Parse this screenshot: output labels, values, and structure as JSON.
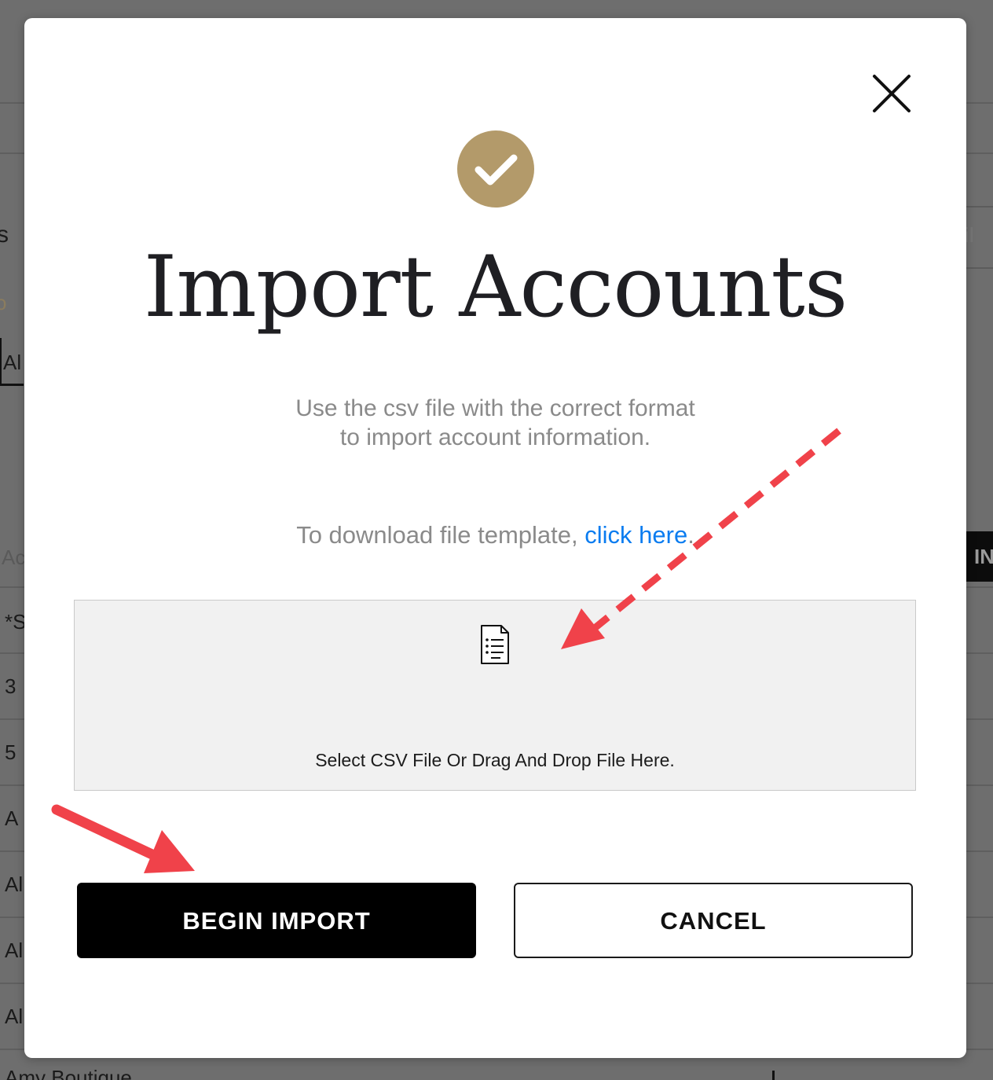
{
  "background": {
    "fragments": [
      "s",
      "o",
      "Al",
      "Ac",
      "*S",
      "3",
      "5",
      "A",
      "Al",
      "Al",
      "Al",
      "Amy Boutique",
      "il",
      "IN"
    ]
  },
  "modal": {
    "title": "Import Accounts",
    "description_line1": "Use the csv file with the correct format",
    "description_line2": "to import account information.",
    "template_prefix": "To download file template, ",
    "template_link": "click here",
    "template_suffix": ".",
    "dropzone_label": "Select CSV File Or Drag And Drop File Here.",
    "primary_button": "BEGIN IMPORT",
    "secondary_button": "CANCEL"
  },
  "icons": {
    "close": "close-icon",
    "success": "checkmark-icon",
    "file": "file-list-icon"
  },
  "colors": {
    "overlay": "#6e6e6e",
    "accent_gold": "#b39a6a",
    "link_blue": "#0a7cf0",
    "annotation_red": "#f0424a",
    "dropzone_bg": "#f1f1f1"
  }
}
